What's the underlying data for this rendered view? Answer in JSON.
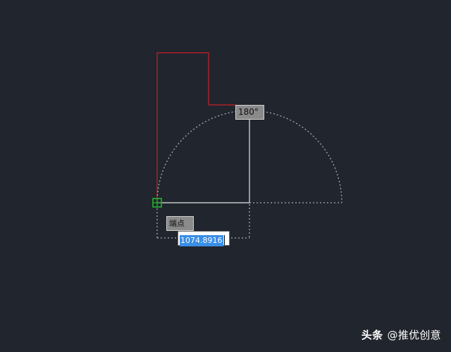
{
  "cad": {
    "angle_tooltip": "180°",
    "snap_tooltip": "端点",
    "length_input_value": "1074.8916",
    "colors": {
      "background": "#21252d",
      "polyline": "#c8202a",
      "tracking_line": "#e6e6e6",
      "arc_guide": "#a8acb2",
      "snap_marker": "#1fbf2a",
      "input_highlight": "#3a8ee6"
    },
    "icons": {
      "snap_marker": "endpoint-snap-marker-icon"
    }
  },
  "watermark": {
    "platform": "头条",
    "author": "@推优创意"
  }
}
